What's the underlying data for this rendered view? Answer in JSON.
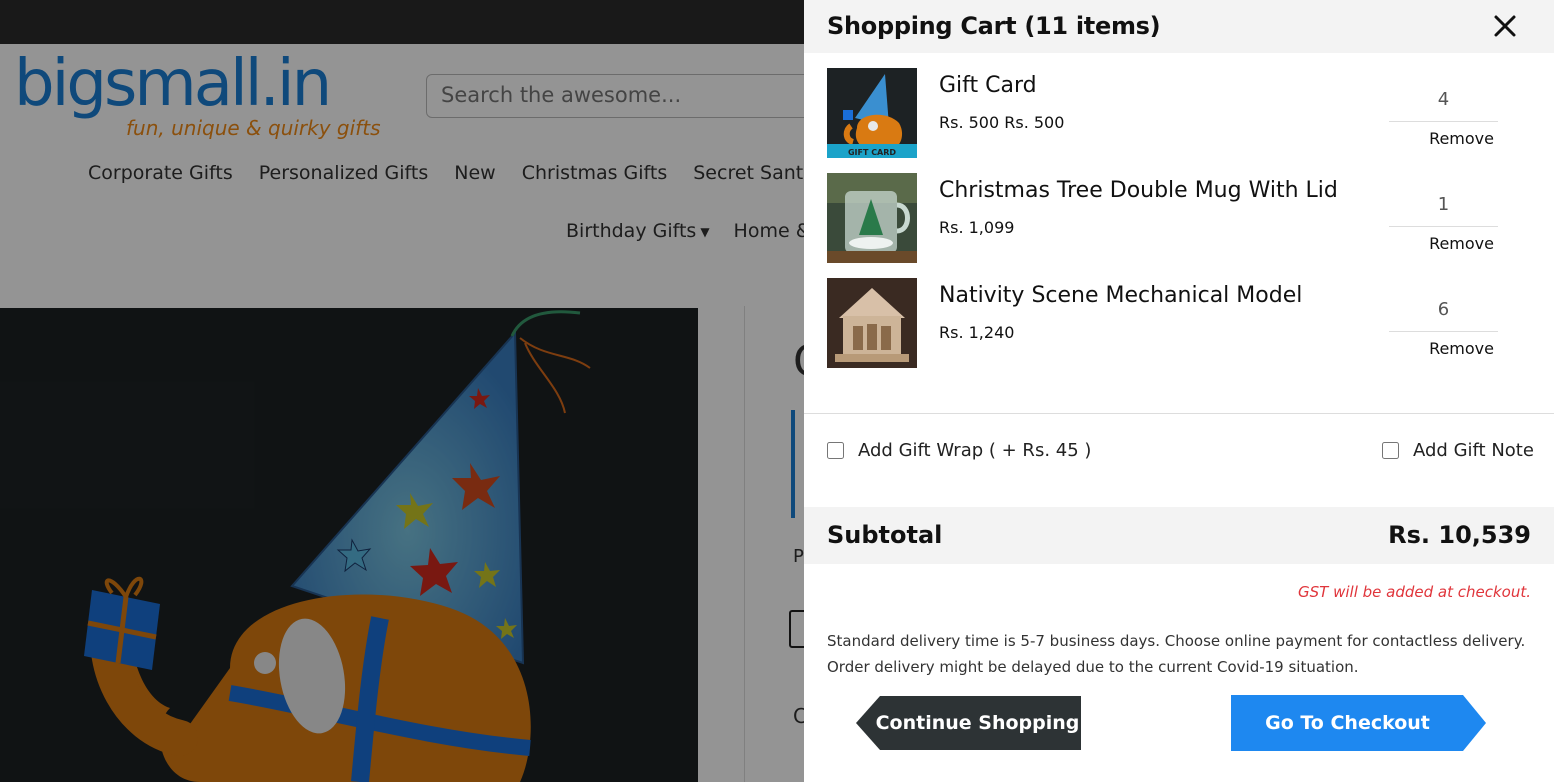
{
  "site": {
    "logo_text": "bigsmall.in",
    "tagline": "fun, unique & quirky gifts",
    "search_placeholder": "Search the awesome...",
    "nav_row1": [
      "Corporate Gifts",
      "Personalized Gifts",
      "New",
      "Christmas Gifts",
      "Secret Santa"
    ],
    "nav_row2": [
      "Birthday Gifts",
      "Home &"
    ],
    "partial_title_char": "G",
    "partial_text_p": "P",
    "partial_text_c": "C"
  },
  "cart": {
    "title": "Shopping Cart (11 items)",
    "close_icon": "close-icon",
    "items": [
      {
        "name": "Gift Card",
        "price": "Rs. 500 Rs. 500",
        "qty": "4",
        "remove": "Remove",
        "thumb_label": "GIFT CARD"
      },
      {
        "name": "Christmas Tree Double Mug With Lid",
        "price": "Rs. 1,099",
        "qty": "1",
        "remove": "Remove"
      },
      {
        "name": "Nativity Scene Mechanical Model",
        "price": "Rs. 1,240",
        "qty": "6",
        "remove": "Remove"
      }
    ],
    "gift_wrap_label": "Add Gift Wrap ( + Rs. 45 )",
    "gift_note_label": "Add Gift Note",
    "subtotal_label": "Subtotal",
    "subtotal_value": "Rs. 10,539",
    "gst_note": "GST will be added at checkout.",
    "delivery_line1": "Standard delivery time is 5-7 business days. Choose online payment for contactless delivery.",
    "delivery_line2": "Order delivery might be delayed due to the current Covid-19 situation.",
    "continue_label": "Continue Shopping",
    "checkout_label": "Go To Checkout"
  },
  "colors": {
    "brand_blue": "#1a7fd4",
    "brand_orange": "#f08a17",
    "checkout_blue": "#1e88f0",
    "continue_dark": "#2d3335",
    "gst_red": "#e0353b"
  }
}
